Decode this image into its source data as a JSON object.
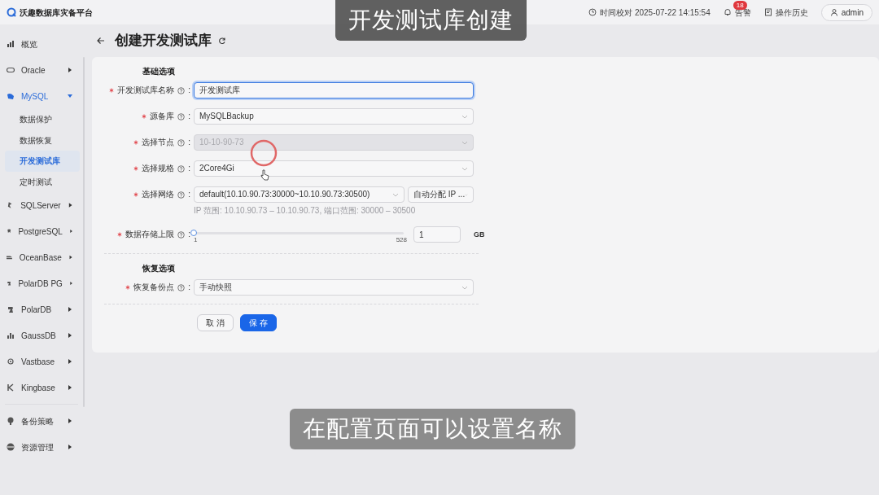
{
  "app": {
    "title": "沃趣数据库灾备平台"
  },
  "header": {
    "time_label": "时间校对 2025-07-22 14:15:54",
    "alerts": {
      "label": "告警",
      "count": "18"
    },
    "history": "操作历史",
    "user": "admin"
  },
  "sidebar": {
    "items": [
      {
        "label": "概览",
        "kind": "link"
      },
      {
        "label": "Oracle",
        "kind": "group",
        "expanded": false
      },
      {
        "label": "MySQL",
        "kind": "group",
        "expanded": true,
        "children": [
          {
            "label": "数据保护",
            "selected": false
          },
          {
            "label": "数据恢复",
            "selected": false
          },
          {
            "label": "开发测试库",
            "selected": true
          },
          {
            "label": "定时测试",
            "selected": false
          }
        ]
      },
      {
        "label": "SQLServer",
        "kind": "group",
        "expanded": false
      },
      {
        "label": "PostgreSQL",
        "kind": "group",
        "expanded": false
      },
      {
        "label": "OceanBase",
        "kind": "group",
        "expanded": false
      },
      {
        "label": "PolarDB PG",
        "kind": "group",
        "expanded": false
      },
      {
        "label": "PolarDB",
        "kind": "group",
        "expanded": false
      },
      {
        "label": "GaussDB",
        "kind": "group",
        "expanded": false
      },
      {
        "label": "Vastbase",
        "kind": "group",
        "expanded": false
      },
      {
        "label": "Kingbase",
        "kind": "group",
        "expanded": false
      },
      {
        "label": "备份策略",
        "kind": "group",
        "expanded": false
      },
      {
        "label": "资源管理",
        "kind": "group",
        "expanded": false
      }
    ]
  },
  "page": {
    "title": "创建开发测试库"
  },
  "sections": [
    {
      "title": "基础选项",
      "fields": [
        {
          "label": "开发测试库名称",
          "separator": ":",
          "kind": "input",
          "required": true,
          "disabled": false,
          "focused": true,
          "value": "开发测试库"
        },
        {
          "label": "源备库",
          "separator": ":",
          "kind": "select",
          "required": true,
          "disabled": false,
          "focused": false,
          "value": "MySQLBackup"
        },
        {
          "label": "选择节点",
          "separator": ":",
          "kind": "select",
          "required": true,
          "disabled": true,
          "focused": false,
          "value": "10-10-90-73"
        },
        {
          "label": "选择规格",
          "separator": ":",
          "kind": "select",
          "required": true,
          "disabled": false,
          "focused": false,
          "value": "2Core4Gi"
        },
        {
          "label": "选择网络",
          "separator": ":",
          "kind": "network",
          "required": true,
          "disabled": false,
          "focused": false,
          "value": "default(10.10.90.73:30000~10.10.90.73:30500)",
          "secondary": "自动分配 IP ...",
          "hint": "IP 范围: 10.10.90.73 – 10.10.90.73, 端口范围: 30000 – 30500"
        },
        {
          "label": "数据存储上限",
          "separator": ":",
          "kind": "slider",
          "required": true,
          "disabled": false,
          "focused": false,
          "level": 0,
          "min": "1",
          "max": "528",
          "value": "1",
          "unit": "GB"
        }
      ]
    },
    {
      "title": "恢复选项",
      "fields": [
        {
          "label": "恢复备份点",
          "separator": ":",
          "kind": "select",
          "required": true,
          "disabled": false,
          "focused": false,
          "value": "手动快照"
        }
      ]
    }
  ],
  "buttons": [
    {
      "label": "取 消",
      "kind": "secondary"
    },
    {
      "label": "保 存",
      "kind": "primary"
    }
  ],
  "captions": {
    "top": "开发测试库创建",
    "bottom": "在配置页面可以设置名称"
  }
}
